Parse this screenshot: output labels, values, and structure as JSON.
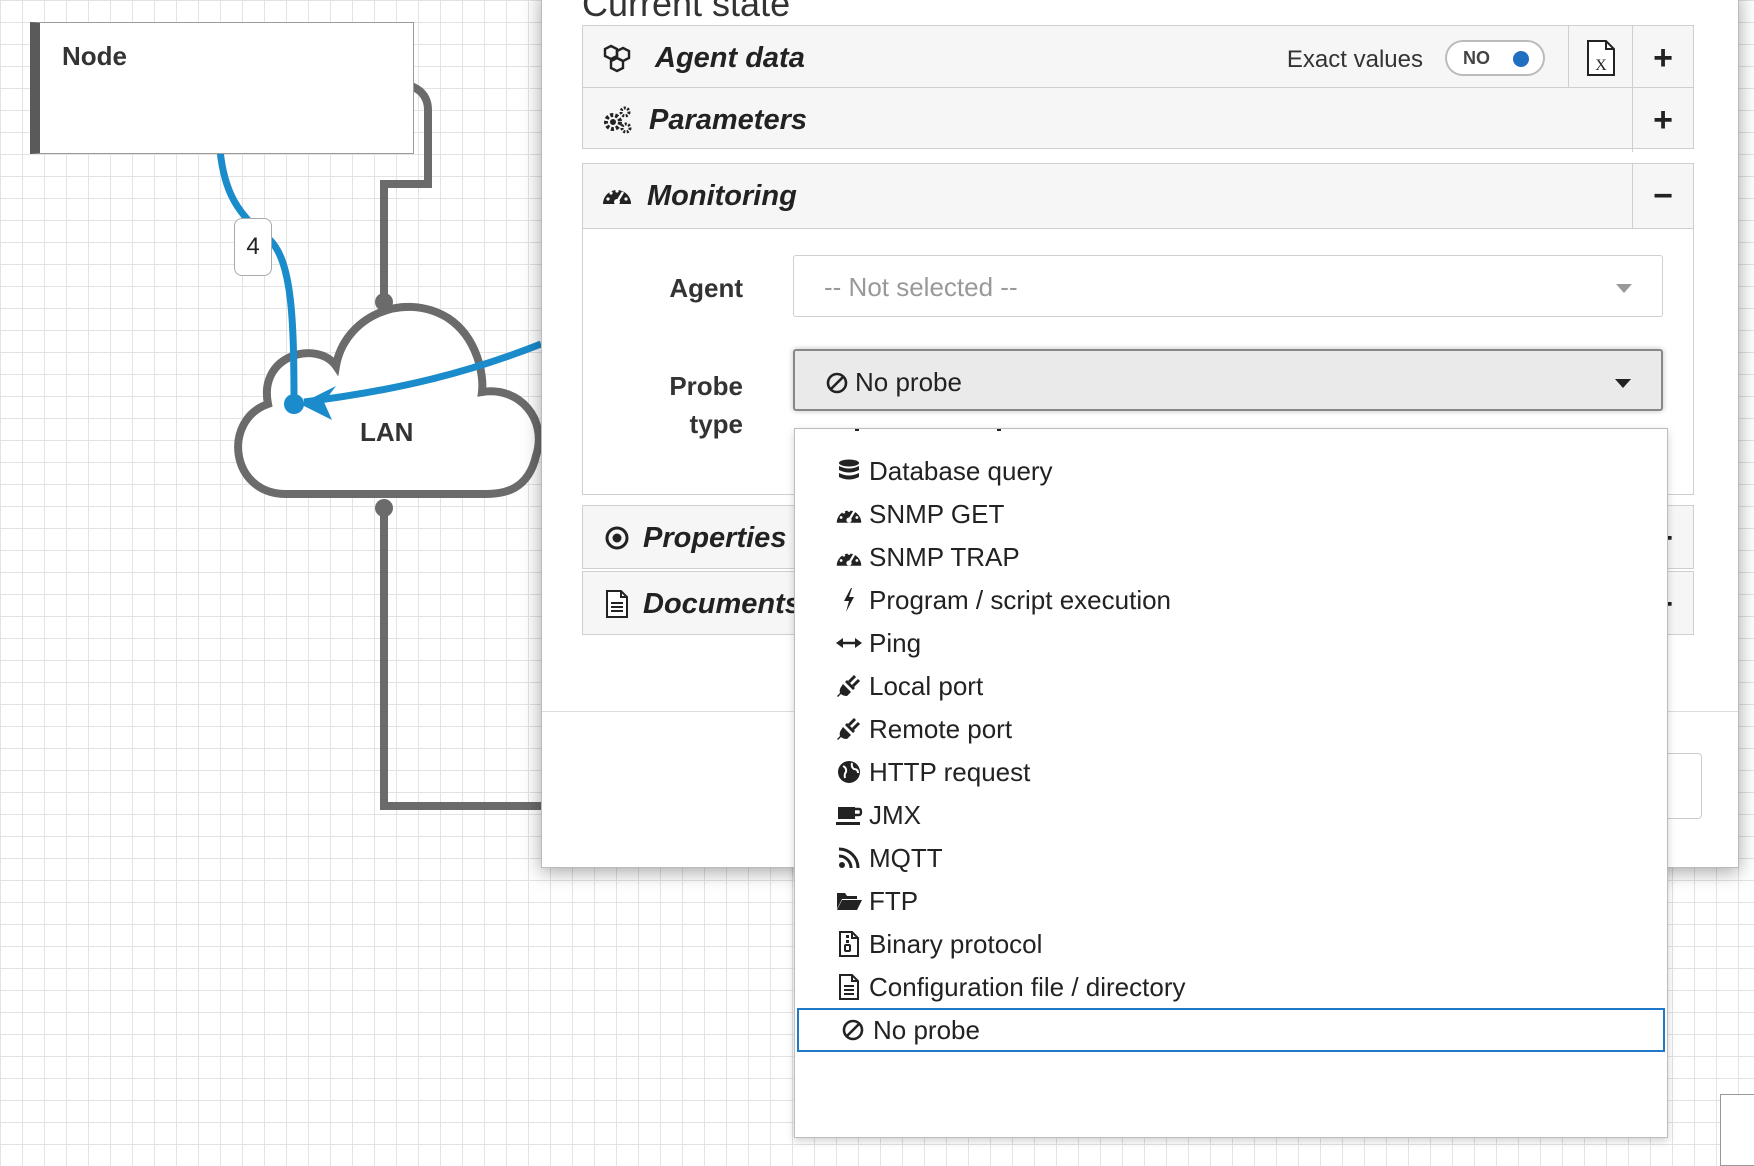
{
  "diagram": {
    "node_title": "Node",
    "edge_label": "4",
    "cloud_label": "LAN"
  },
  "dialog": {
    "title": "Current state",
    "panels": {
      "agent_data": {
        "title": "Agent data",
        "exact_values_label": "Exact values",
        "toggle_text": "NO",
        "toggle_state": "off",
        "file_icon": "excel-file-icon",
        "control": "+"
      },
      "parameters": {
        "title": "Parameters",
        "control": "+"
      },
      "monitoring": {
        "title": "Monitoring",
        "control": "−"
      },
      "properties": {
        "title": "Properties",
        "control": "+"
      },
      "documents": {
        "title": "Documents",
        "control": "+"
      }
    },
    "monitoring_form": {
      "agent_label": "Agent",
      "agent_placeholder": "-- Not selected --",
      "probe_label_line1": "Probe",
      "probe_label_line2": "type",
      "probe_value": "No probe"
    }
  },
  "dropdown": {
    "items": [
      {
        "label": "Database query",
        "icon": "database-icon"
      },
      {
        "label": "SNMP GET",
        "icon": "dashboard-icon"
      },
      {
        "label": "SNMP TRAP",
        "icon": "dashboard-icon"
      },
      {
        "label": "Program / script execution",
        "icon": "bolt-icon"
      },
      {
        "label": "Ping",
        "icon": "arrows-h-icon"
      },
      {
        "label": "Local port",
        "icon": "plug-icon"
      },
      {
        "label": "Remote port",
        "icon": "plug-icon"
      },
      {
        "label": "HTTP request",
        "icon": "globe-icon"
      },
      {
        "label": "JMX",
        "icon": "coffee-icon"
      },
      {
        "label": "MQTT",
        "icon": "rss-icon"
      },
      {
        "label": "FTP",
        "icon": "folder-open-icon"
      },
      {
        "label": "Binary protocol",
        "icon": "file-zip-icon"
      },
      {
        "label": "Configuration file / directory",
        "icon": "file-text-icon"
      },
      {
        "label": "No probe",
        "icon": "ban-icon",
        "selected": true
      }
    ]
  },
  "colors": {
    "link_blue": "#1a8ccc",
    "connector_gray": "#6b6b6b",
    "selection_blue": "#1f78c8"
  }
}
